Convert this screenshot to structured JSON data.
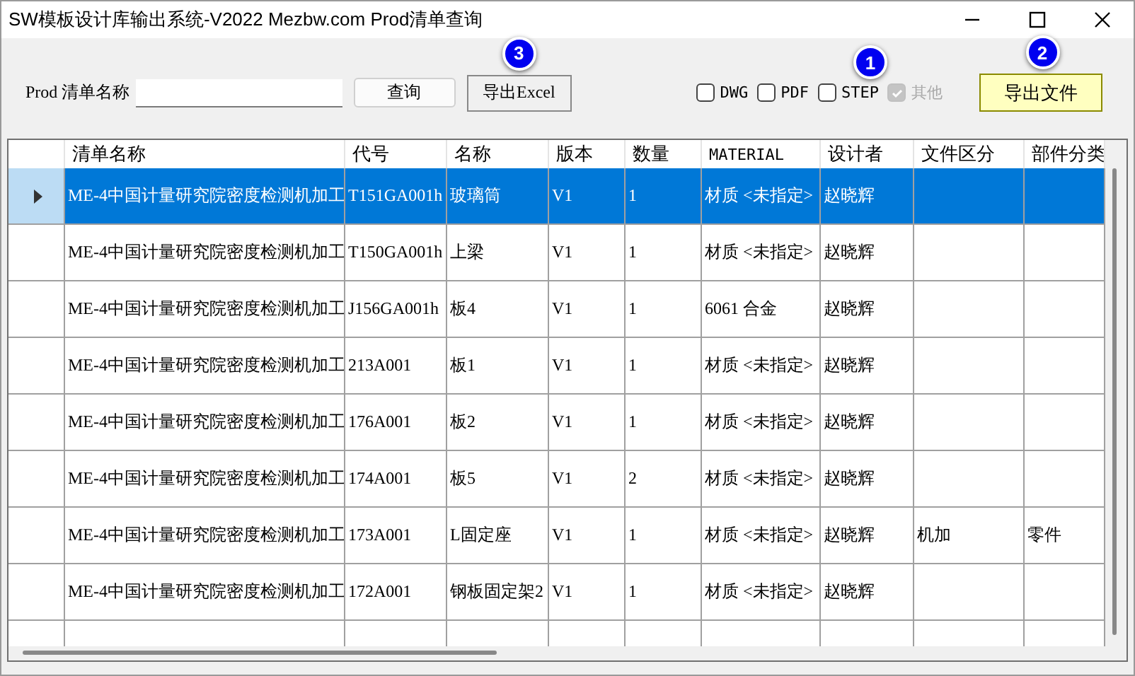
{
  "window": {
    "title": "SW模板设计库输出系统-V2022 Mezbw.com Prod清单查询"
  },
  "toolbar": {
    "name_label": "Prod 清单名称",
    "query_button": "查询",
    "excel_button": {
      "label": "导出Excel",
      "badge": "3"
    },
    "checkboxes": [
      {
        "label": "DWG",
        "checked": false,
        "disabled": false
      },
      {
        "label": "PDF",
        "checked": false,
        "disabled": false
      },
      {
        "label": "STEP",
        "checked": false,
        "disabled": false,
        "badge": "1"
      },
      {
        "label": "其他",
        "checked": true,
        "disabled": true
      }
    ],
    "export_button": {
      "label": "导出文件",
      "badge": "2"
    }
  },
  "table": {
    "columns": [
      "清单名称",
      "代号",
      "名称",
      "版本",
      "数量",
      "MATERIAL",
      "设计者",
      "文件区分",
      "部件分类"
    ],
    "rows": [
      {
        "selected": true,
        "cells": [
          "ME-4中国计量研究院密度检测机加工",
          "T151GA001h",
          "玻璃筒",
          "V1",
          "1",
          "材质 <未指定>",
          "赵晓辉",
          "",
          ""
        ]
      },
      {
        "selected": false,
        "cells": [
          "ME-4中国计量研究院密度检测机加工",
          "T150GA001h",
          "上梁",
          "V1",
          "1",
          "材质 <未指定>",
          "赵晓辉",
          "",
          ""
        ]
      },
      {
        "selected": false,
        "cells": [
          "ME-4中国计量研究院密度检测机加工",
          "J156GA001h",
          "板4",
          "V1",
          "1",
          "6061 合金",
          "赵晓辉",
          "",
          ""
        ]
      },
      {
        "selected": false,
        "cells": [
          "ME-4中国计量研究院密度检测机加工",
          "213A001",
          "板1",
          "V1",
          "1",
          "材质 <未指定>",
          "赵晓辉",
          "",
          ""
        ]
      },
      {
        "selected": false,
        "cells": [
          "ME-4中国计量研究院密度检测机加工",
          "176A001",
          "板2",
          "V1",
          "1",
          "材质 <未指定>",
          "赵晓辉",
          "",
          ""
        ]
      },
      {
        "selected": false,
        "cells": [
          "ME-4中国计量研究院密度检测机加工",
          "174A001",
          "板5",
          "V1",
          "2",
          "材质 <未指定>",
          "赵晓辉",
          "",
          ""
        ]
      },
      {
        "selected": false,
        "cells": [
          "ME-4中国计量研究院密度检测机加工",
          "173A001",
          "L固定座",
          "V1",
          "1",
          "材质 <未指定>",
          "赵晓辉",
          "机加",
          "零件"
        ]
      },
      {
        "selected": false,
        "cells": [
          "ME-4中国计量研究院密度检测机加工",
          "172A001",
          "钢板固定架2",
          "V1",
          "1",
          "材质 <未指定>",
          "赵晓辉",
          "",
          ""
        ]
      }
    ]
  }
}
